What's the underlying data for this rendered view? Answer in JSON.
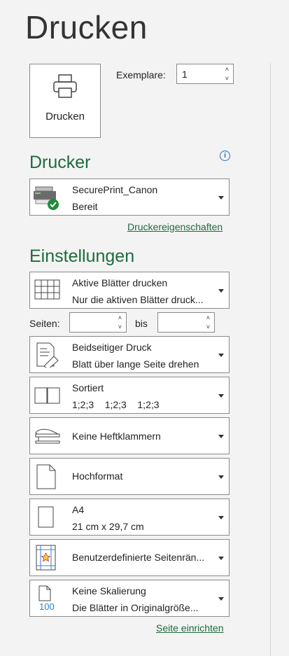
{
  "page": {
    "title": "Drucken"
  },
  "print_button": {
    "label": "Drucken"
  },
  "copies": {
    "label": "Exemplare:",
    "value": "1"
  },
  "printer": {
    "heading": "Drucker",
    "name": "SecurePrint_Canon",
    "status": "Bereit",
    "properties_link": "Druckereigenschaften"
  },
  "settings": {
    "heading": "Einstellungen",
    "scope": {
      "title": "Aktive Blätter drucken",
      "subtitle": "Nur die aktiven Blätter druck..."
    },
    "pages": {
      "label": "Seiten:",
      "to_label": "bis",
      "from_value": "",
      "to_value": ""
    },
    "duplex": {
      "title": "Beidseitiger Druck",
      "subtitle": "Blatt über lange Seite drehen"
    },
    "collate": {
      "title": "Sortiert",
      "subtitle": "1;2;3    1;2;3    1;2;3"
    },
    "staple": {
      "title": "Keine Heftklammern"
    },
    "orientation": {
      "title": "Hochformat"
    },
    "paper": {
      "title": "A4",
      "subtitle": "21 cm x 29,7 cm"
    },
    "margins": {
      "title": "Benutzerdefinierte Seitenrän..."
    },
    "scaling": {
      "title": "Keine Skalierung",
      "subtitle": "Die Blätter in Originalgröße...",
      "icon_text": "100"
    },
    "page_setup_link": "Seite einrichten"
  }
}
